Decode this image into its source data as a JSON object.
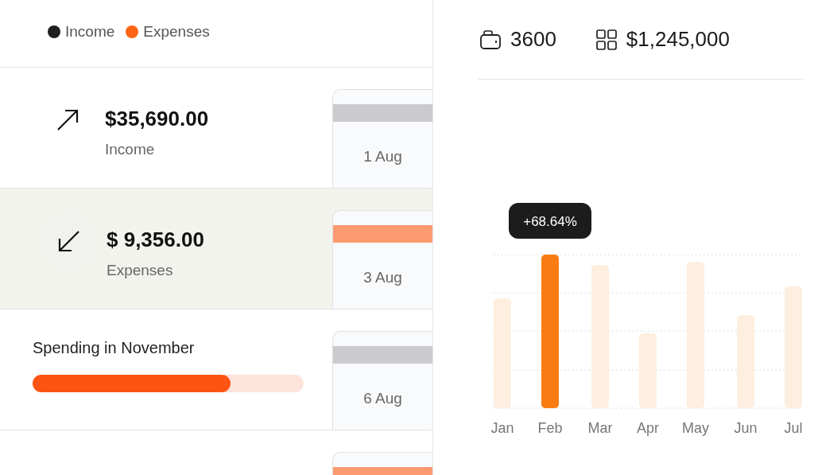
{
  "legend": [
    {
      "label": "Income",
      "color": "#1f1f1f"
    },
    {
      "label": "Expenses",
      "color": "#fd6414"
    }
  ],
  "rows": [
    {
      "kind": "income",
      "amount": "$35,690.00",
      "label": "Income",
      "selected": false,
      "card": {
        "date": "1 Aug",
        "color": "#cbcbcd"
      }
    },
    {
      "kind": "expense",
      "amount": "$ 9,356.00",
      "label": "Expenses",
      "selected": true,
      "card": {
        "date": "3 Aug",
        "color": "#fe9a70"
      }
    },
    {
      "kind": "progress",
      "title": "Spending in November",
      "level": 0.73,
      "selected": false,
      "card": {
        "date": "6 Aug",
        "color": "#cbcbcd"
      }
    },
    {
      "kind": "empty",
      "selected": false,
      "card": {
        "color": "#fe9a70"
      }
    }
  ],
  "stats": [
    {
      "value": "3600"
    },
    {
      "value": "$1,245,000"
    }
  ],
  "chart": {
    "tooltip": "+68.64%",
    "months": [
      {
        "label": "Jan",
        "selected": false
      },
      {
        "label": "Feb",
        "selected": true
      },
      {
        "label": "Mar",
        "selected": false
      },
      {
        "label": "Apr",
        "selected": false
      },
      {
        "label": "May",
        "selected": false
      },
      {
        "label": "Jun",
        "selected": false
      },
      {
        "label": "Jul",
        "selected": false
      }
    ]
  }
}
